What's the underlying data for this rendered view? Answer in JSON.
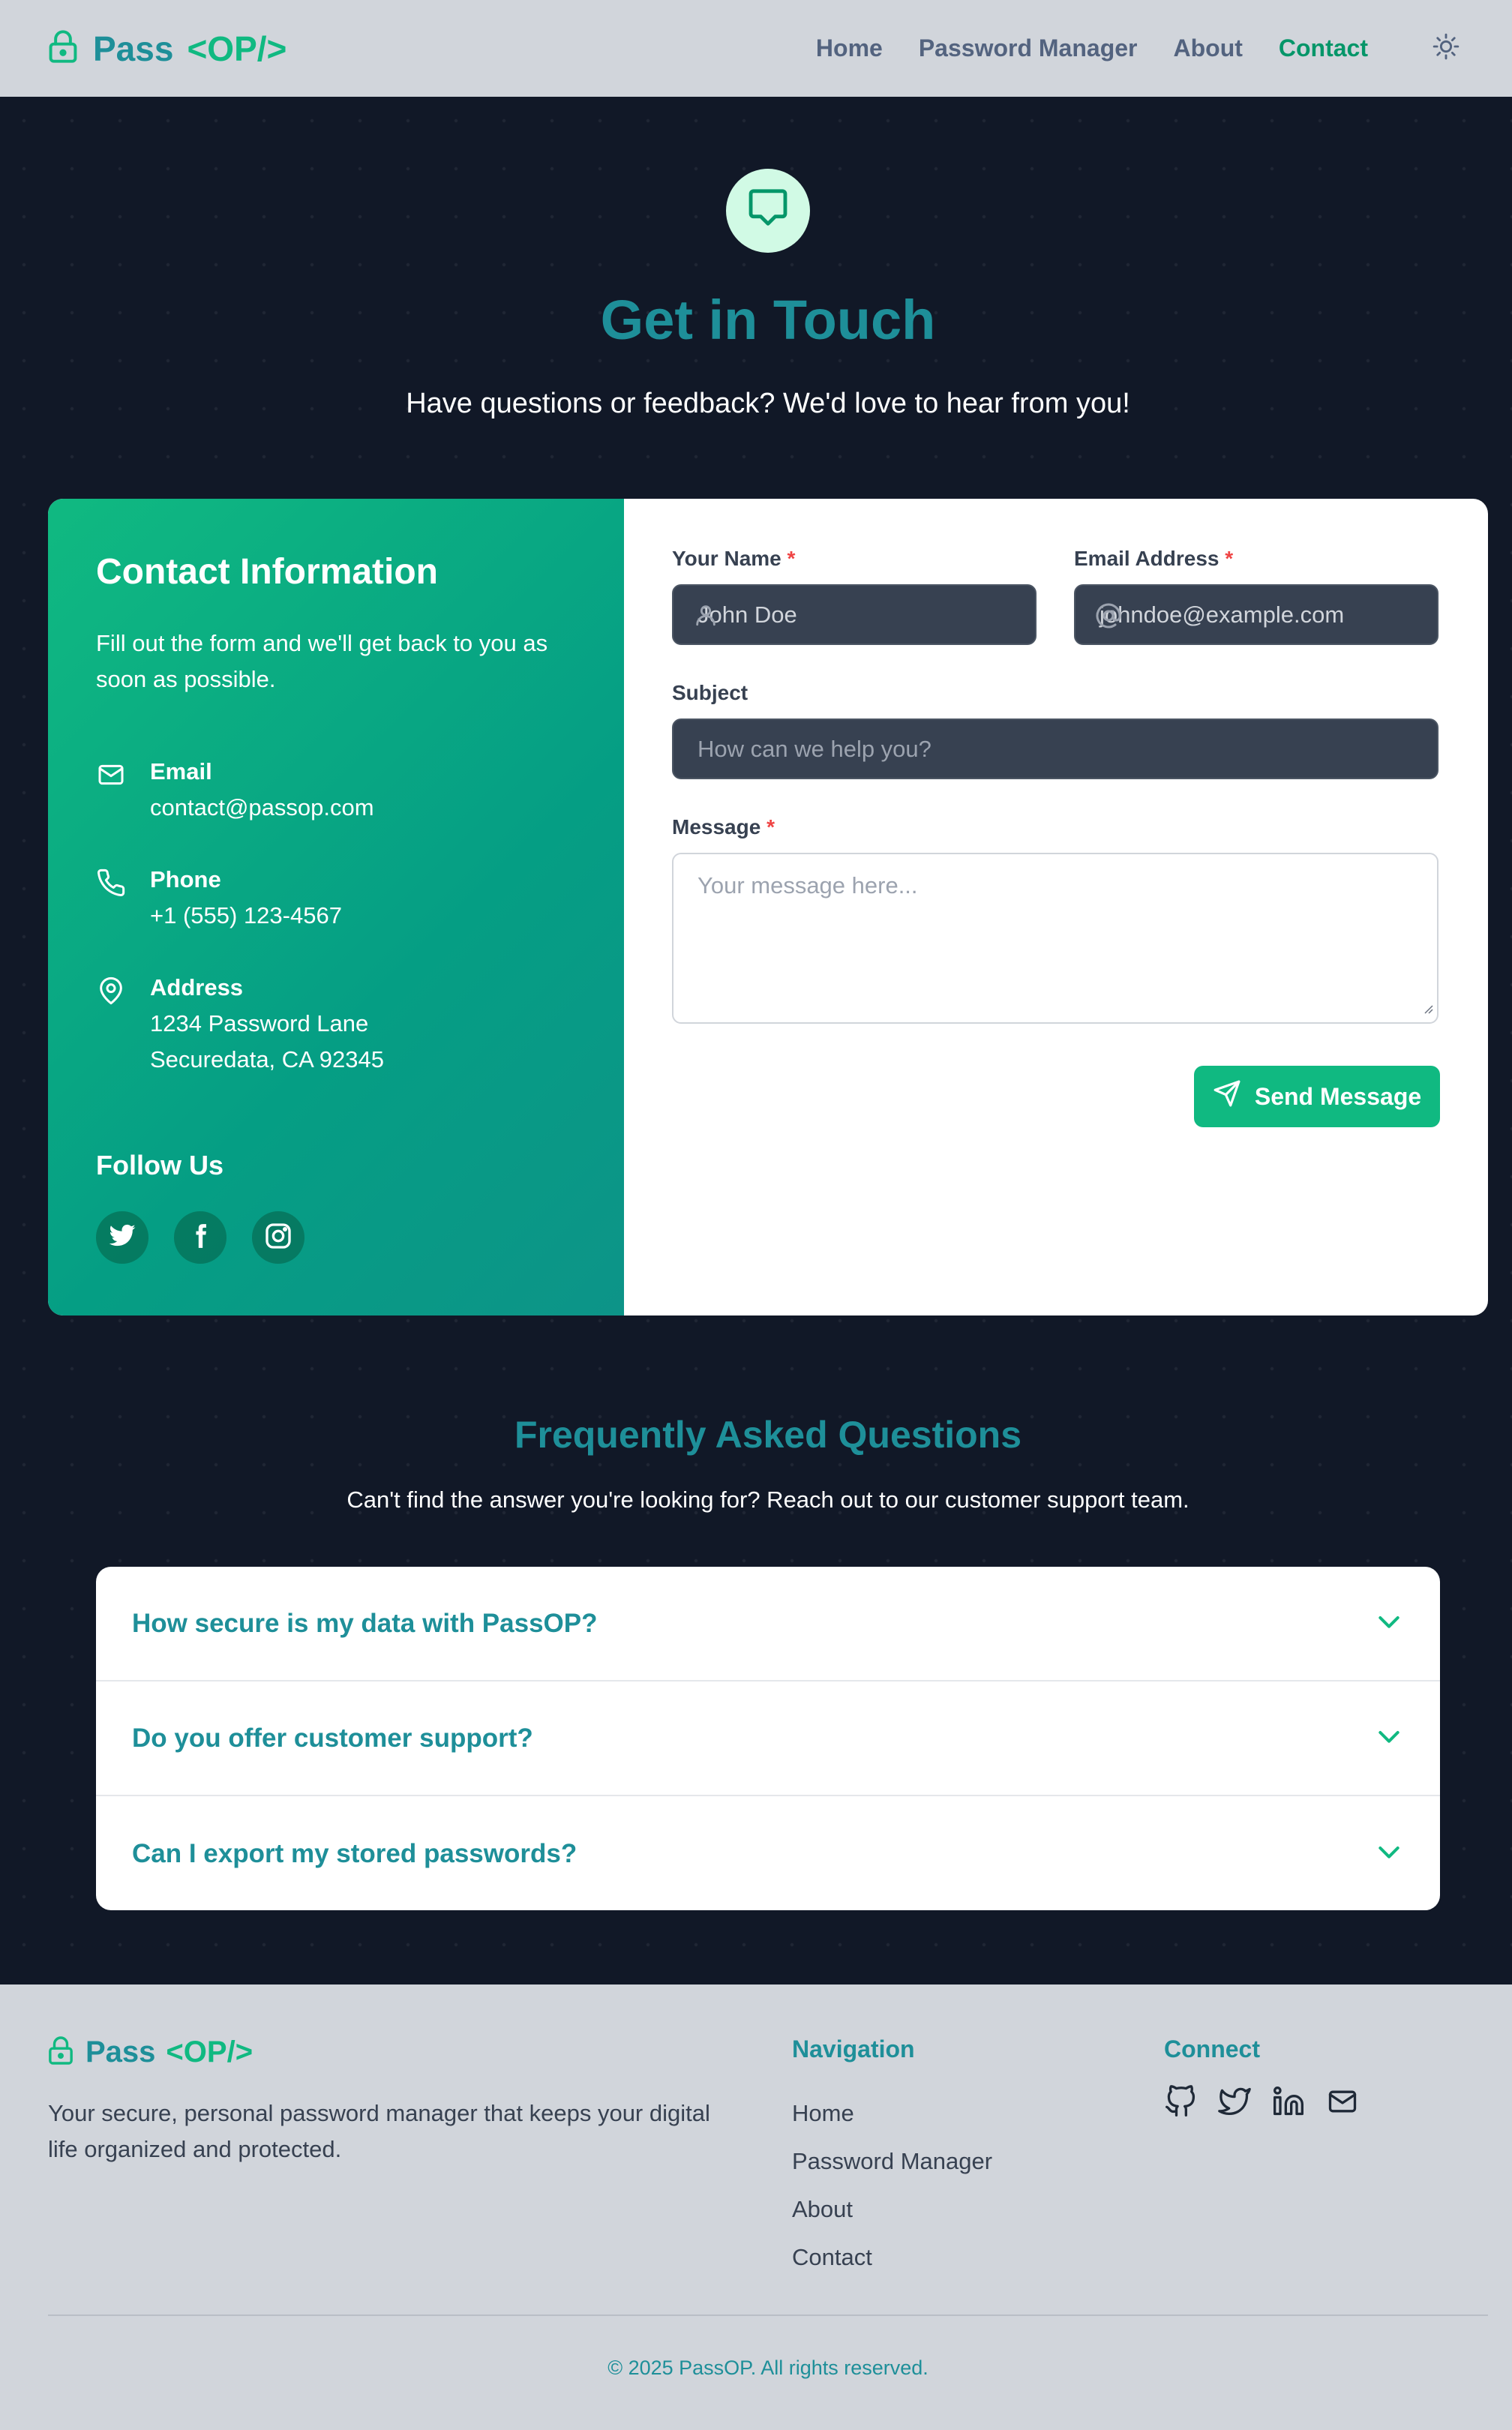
{
  "header": {
    "brand": "Pass",
    "brand_accent": "<OP/>",
    "nav": [
      {
        "label": "Home"
      },
      {
        "label": "Password Manager"
      },
      {
        "label": "About"
      },
      {
        "label": "Contact"
      }
    ],
    "active_nav": "Contact",
    "theme_icon": "sun-icon"
  },
  "hero": {
    "icon": "message-icon",
    "title": "Get in Touch",
    "subtitle": "Have questions or feedback? We'd love to hear from you!"
  },
  "contact_info": {
    "title": "Contact Information",
    "description": "Fill out the form and we'll get back to you as soon as possible.",
    "email": {
      "label": "Email",
      "value": "contact@passop.com"
    },
    "phone": {
      "label": "Phone",
      "value": "+1 (555) 123-4567"
    },
    "address": {
      "label": "Address",
      "line1": "1234 Password Lane",
      "line2": "Securedata, CA 92345"
    },
    "follow_title": "Follow Us",
    "socials": [
      "twitter-icon",
      "facebook-icon",
      "instagram-icon"
    ]
  },
  "form": {
    "name": {
      "label": "Your Name",
      "required": "*",
      "value": "John Doe"
    },
    "email": {
      "label": "Email Address",
      "required": "*",
      "value": "johndoe@example.com"
    },
    "subject": {
      "label": "Subject",
      "placeholder": "How can we help you?"
    },
    "message": {
      "label": "Message",
      "required": "*",
      "placeholder": "Your message here..."
    },
    "submit_label": "Send Message"
  },
  "faq": {
    "title": "Frequently Asked Questions",
    "subtitle": "Can't find the answer you're looking for? Reach out to our customer support team.",
    "items": [
      {
        "question": "How secure is my data with PassOP?"
      },
      {
        "question": "Do you offer customer support?"
      },
      {
        "question": "Can I export my stored passwords?"
      }
    ]
  },
  "footer": {
    "brand": "Pass",
    "brand_accent": "<OP/>",
    "description": "Your secure, personal password manager that keeps your digital life organized and protected.",
    "nav_title": "Navigation",
    "nav_links": [
      {
        "label": "Home"
      },
      {
        "label": "Password Manager"
      },
      {
        "label": "About"
      },
      {
        "label": "Contact"
      }
    ],
    "connect_title": "Connect",
    "connect_icons": [
      "github-icon",
      "twitter-icon",
      "linkedin-icon",
      "mail-icon"
    ],
    "copyright": "© 2025 PassOP. All rights reserved."
  },
  "colors": {
    "brand": "#1e8f99",
    "accent": "#10b981",
    "background": "#111827",
    "navbar": "#d1d5db"
  }
}
